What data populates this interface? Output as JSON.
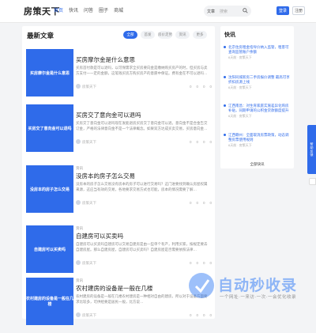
{
  "header": {
    "logo": "房策天下",
    "nav": [
      "首页",
      "快讯",
      "问答",
      "圈子",
      "商城"
    ],
    "search_scope": "文章",
    "search_placeholder": "搜索",
    "login": "登录",
    "register": "注册"
  },
  "main": {
    "title": "最新文章",
    "tabs": [
      "全部",
      "首发",
      "房价走势",
      "资讯",
      "更多"
    ],
    "articles": [
      {
        "tag": "",
        "title": "买房摩尔金是什么意思",
        "thumb": "买房摩尔金是什么意思",
        "summary": "买房首付款是可以退吗，以可保需求全买房要向金是缴纳购买房产的时，但买房与卖方支付一一定的金额，这笔钱买房方购买房产的意愿中保证。费有金在不可以退吗…",
        "author": "房策天下",
        "stats": [
          "0",
          "0",
          "0",
          "0"
        ]
      },
      {
        "tag": "",
        "title": "买房交了意向金可以退吗",
        "thumb": "买房交了意向金可以退吗",
        "summary": "买房交了意向金可以退吗现在发能退房买房交了意向金可以退。意向金不是合金告交订金，严格的法律意向金不是一个法律概念。如果双方达成买卖交易，买房意向金…",
        "author": "房策天下",
        "stats": [
          "0",
          "0",
          "0",
          "0"
        ]
      },
      {
        "tag": "资讯",
        "title": "没房本的房子怎么交易",
        "thumb": "没房本的房子怎么交易",
        "summary": "没房本的房子怎么交易没有房本的房子可以进行交易吗？这门进要找到确认房屋权属来源，这应当有效的交易，各地要求交易方式也可能，房本的情况需要了解…",
        "author": "房策天下",
        "stats": [
          "0",
          "0",
          "0",
          "0"
        ]
      },
      {
        "tag": "资讯",
        "title": "自建房可以买卖吗",
        "thumb": "自建房可以买卖吗",
        "summary": "自建房可以买卖吗自建房可以交易自建房是由一些单个有产，利用买家，按规定要去自建房屋。那么自建房屋，自建房可以买卖吗？自建房屋是否需要依照法律…",
        "author": "房策天下",
        "stats": [
          "0",
          "0",
          "0",
          "0"
        ]
      },
      {
        "tag": "资讯",
        "title": "农村建房的设备是一般在几楼",
        "thumb": "农村建房的设备是一般在几楼",
        "summary": "农村建房的设备是一般在几楼农村建房是一种相对自由的建房，所以对于设备方面要求比较多，可供给要是居民一般，比方说…",
        "author": "房策天下",
        "stats": [
          "0",
          "0",
          "0",
          "0"
        ]
      }
    ]
  },
  "sidebar": {
    "title": "快讯",
    "news": [
      {
        "text": "北京住房租金指导价纳入监管，租客可查询监管账户余额",
        "time": "6天前 · 房策天下"
      },
      {
        "text": "沈阳同城新房二手房报价调整 最高可享折扣房源上线",
        "time": "6天前 · 房策天下"
      },
      {
        "text": "江西南昌：对生育家庭实施差异化购房补贴，同期申请的公积金贷款额度提升",
        "time": "6天前 · 房策天下"
      },
      {
        "text": "江西赣州：全面取消房票政策，动态调整房票使用规则",
        "time": "6天前 · 房策天下"
      }
    ],
    "more": "全部快讯"
  },
  "float": {
    "label": "帮助反馈"
  },
  "watermark": {
    "text": "自动秒收录",
    "sub": "一个网址·一来访·一次·一会优化收录"
  }
}
